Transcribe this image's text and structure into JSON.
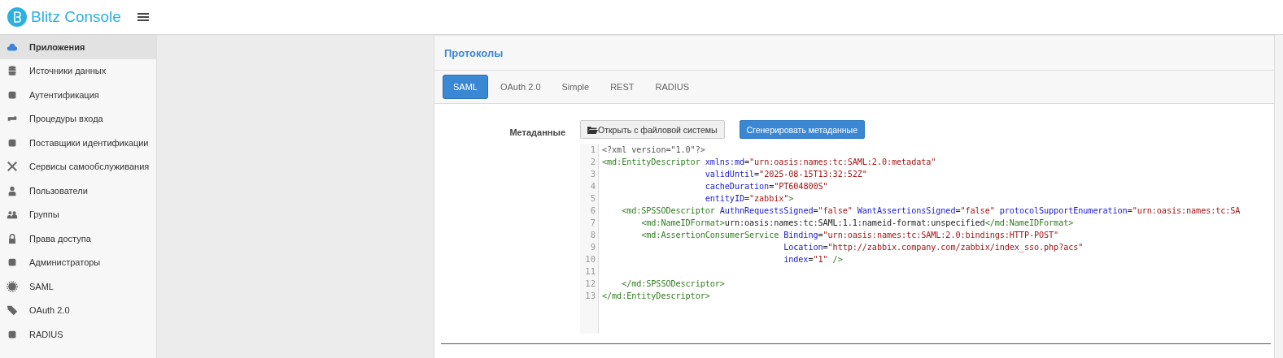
{
  "header": {
    "title": "Blitz Console"
  },
  "sidebar": {
    "items": [
      {
        "label": "Приложения",
        "selected": true
      },
      {
        "label": "Источники данных",
        "selected": false
      },
      {
        "label": "Аутентификация",
        "selected": false
      },
      {
        "label": "Процедуры входа",
        "selected": false
      },
      {
        "label": "Поставщики идентификации",
        "selected": false
      },
      {
        "label": "Сервисы самообслуживания",
        "selected": false
      },
      {
        "label": "Пользователи",
        "selected": false
      },
      {
        "label": "Группы",
        "selected": false
      },
      {
        "label": "Права доступа",
        "selected": false
      },
      {
        "label": "Администраторы",
        "selected": false
      },
      {
        "label": "SAML",
        "selected": false
      },
      {
        "label": "OAuth 2.0",
        "selected": false
      },
      {
        "label": "RADIUS",
        "selected": false
      }
    ]
  },
  "panel": {
    "title": "Протоколы",
    "tabs": [
      {
        "label": "SAML",
        "selected": true
      },
      {
        "label": "OAuth 2.0",
        "selected": false
      },
      {
        "label": "Simple",
        "selected": false
      },
      {
        "label": "REST",
        "selected": false
      },
      {
        "label": "RADIUS",
        "selected": false
      }
    ],
    "field_label": "Метаданные",
    "buttons": [
      {
        "label": "Открыть с файловой системы",
        "kind": "default"
      },
      {
        "label": "Сгенерировать метаданные",
        "kind": "primary"
      }
    ],
    "editor": {
      "lines": [
        {
          "number": "1",
          "tokens": [
            {
              "kind": "pi",
              "text": "<?xml version=\"1.0\"?>"
            }
          ]
        },
        {
          "number": "2",
          "tokens": [
            {
              "kind": "tag",
              "text": "<md:EntityDescriptor"
            },
            {
              "kind": "attr",
              "text": " xmlns:md"
            },
            {
              "kind": "plain",
              "text": "="
            },
            {
              "kind": "str",
              "text": "\"urn:oasis:names:tc:SAML:2.0:metadata\""
            }
          ]
        },
        {
          "number": "3",
          "tokens": [
            {
              "kind": "attr",
              "text": "                     validUntil"
            },
            {
              "kind": "plain",
              "text": "="
            },
            {
              "kind": "str",
              "text": "\"2025-08-15T13:32:52Z\""
            }
          ]
        },
        {
          "number": "4",
          "tokens": [
            {
              "kind": "attr",
              "text": "                     cacheDuration"
            },
            {
              "kind": "plain",
              "text": "="
            },
            {
              "kind": "str",
              "text": "\"PT604800S\""
            }
          ]
        },
        {
          "number": "5",
          "tokens": [
            {
              "kind": "attr",
              "text": "                     entityID"
            },
            {
              "kind": "plain",
              "text": "="
            },
            {
              "kind": "str",
              "text": "\"zabbix\""
            },
            {
              "kind": "tag",
              "text": ">"
            }
          ]
        },
        {
          "number": "6",
          "tokens": [
            {
              "kind": "tag",
              "text": "    <md:SPSSODescriptor"
            },
            {
              "kind": "attr",
              "text": " AuthnRequestsSigned"
            },
            {
              "kind": "plain",
              "text": "="
            },
            {
              "kind": "str",
              "text": "\"false\""
            },
            {
              "kind": "attr",
              "text": " WantAssertionsSigned"
            },
            {
              "kind": "plain",
              "text": "="
            },
            {
              "kind": "str",
              "text": "\"false\""
            },
            {
              "kind": "attr",
              "text": " protocolSupportEnumeration"
            },
            {
              "kind": "plain",
              "text": "="
            },
            {
              "kind": "str",
              "text": "\"urn:oasis:names:tc:SA"
            }
          ]
        },
        {
          "number": "7",
          "tokens": [
            {
              "kind": "tag",
              "text": "        <md:NameIDFormat>"
            },
            {
              "kind": "plain",
              "text": "urn:oasis:names:tc:SAML:1.1:nameid-format:unspecified"
            },
            {
              "kind": "tag",
              "text": "</md:NameIDFormat>"
            }
          ]
        },
        {
          "number": "8",
          "tokens": [
            {
              "kind": "tag",
              "text": "        <md:AssertionConsumerService"
            },
            {
              "kind": "attr",
              "text": " Binding"
            },
            {
              "kind": "plain",
              "text": "="
            },
            {
              "kind": "str",
              "text": "\"urn:oasis:names:tc:SAML:2.0:bindings:HTTP-POST\""
            }
          ]
        },
        {
          "number": "9",
          "tokens": [
            {
              "kind": "attr",
              "text": "                                     Location"
            },
            {
              "kind": "plain",
              "text": "="
            },
            {
              "kind": "str",
              "text": "\"http://zabbix.company.com/zabbix/index_sso.php?acs\""
            }
          ]
        },
        {
          "number": "10",
          "tokens": [
            {
              "kind": "attr",
              "text": "                                     index"
            },
            {
              "kind": "plain",
              "text": "="
            },
            {
              "kind": "str",
              "text": "\"1\""
            },
            {
              "kind": "tag",
              "text": " />"
            }
          ]
        },
        {
          "number": "11"
        },
        {
          "number": "12",
          "tokens": [
            {
              "kind": "tag",
              "text": "    </md:SPSSODescriptor>"
            }
          ]
        },
        {
          "number": "13",
          "tokens": [
            {
              "kind": "tag",
              "text": "</md:EntityDescriptor>"
            }
          ]
        }
      ]
    }
  }
}
